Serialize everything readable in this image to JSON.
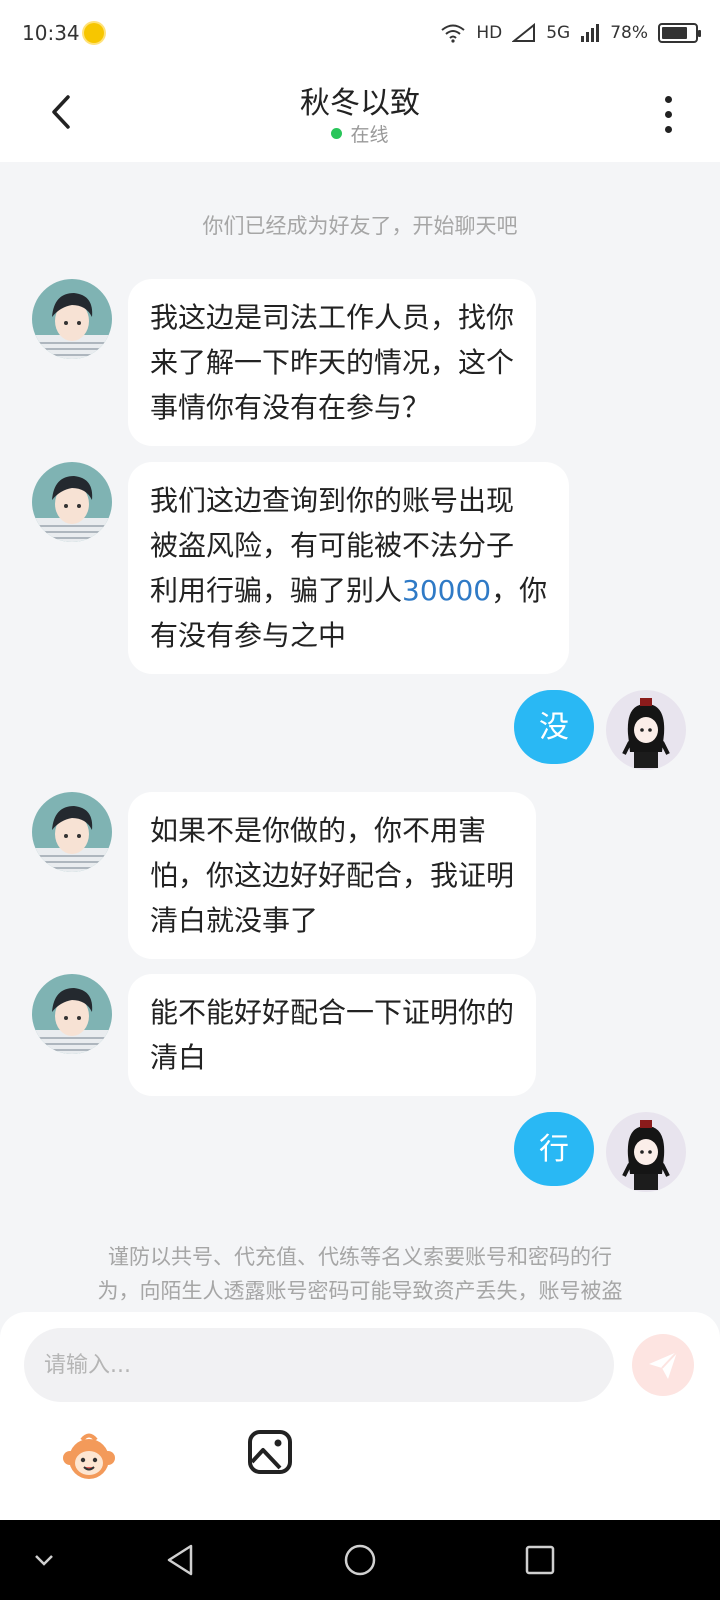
{
  "status_bar": {
    "time": "10:34",
    "network": "HD",
    "signal": "5G",
    "battery": "78%",
    "battery_level": 0.78
  },
  "header": {
    "title": "秋冬以致",
    "presence": "在线",
    "back_icon": "chevron-left-icon",
    "more_icon": "more-vertical-icon"
  },
  "chat": {
    "system_message": "你们已经成为好友了，开始聊天吧",
    "messages": [
      {
        "side": "left",
        "lines": [
          "我这边是司法工作人员，找你",
          "来了解一下昨天的情况，这个",
          "事情你有没有在参与？"
        ]
      },
      {
        "side": "left",
        "lines": [
          "我们这边查询到你的账号出现",
          "被盗风险，有可能被不法分子",
          "利用行骗，骗了别人",
          "30000",
          "，你",
          "有没有参与之中"
        ]
      },
      {
        "side": "right",
        "text": "没"
      },
      {
        "side": "left",
        "lines": [
          "如果不是你做的，你不用害",
          "怕，你这边好好配合，我证明",
          "清白就没事了"
        ]
      },
      {
        "side": "left",
        "lines": [
          "能不能好好配合一下证明你的",
          "清白"
        ]
      },
      {
        "side": "right",
        "text": "行"
      }
    ],
    "warning_lines": [
      "谨防以共号、代充值、代练等名义索要账号和密码的行",
      "为，向陌生人透露账号密码可能导致资产丢失，账号被盗"
    ]
  },
  "composer": {
    "placeholder": "请输入...",
    "send_icon": "send-icon",
    "emoji_icon": "emoji-icon",
    "image_icon": "image-icon"
  },
  "colors": {
    "accent": "#29b8f4",
    "online": "#29c55a",
    "highlight": "#2f7ac6"
  }
}
